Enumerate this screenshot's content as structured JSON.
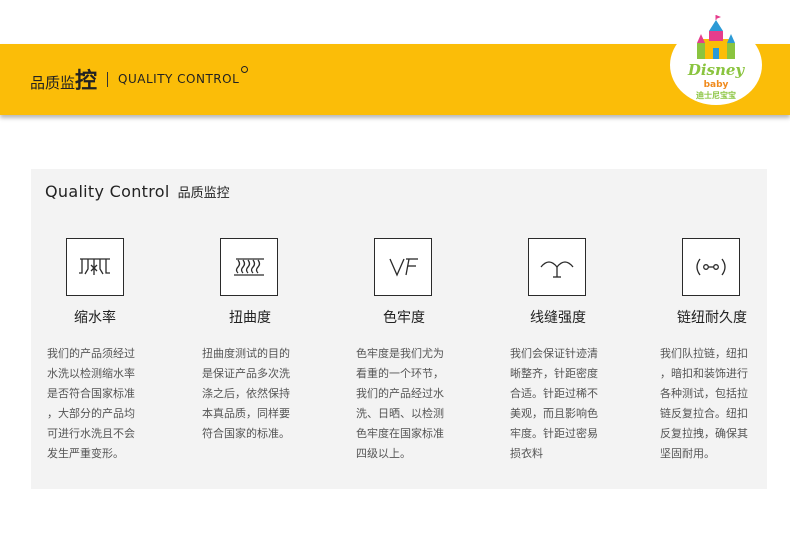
{
  "header": {
    "title_cn_prefix": "品质监",
    "title_cn_big": "控",
    "title_en": "QUALITY  CONTROL",
    "logo_text_en": "Disney",
    "logo_text_sub": "baby",
    "logo_text_cn": "迪士尼宝宝",
    "accent_color": "#fbbd08"
  },
  "panel": {
    "title_en": "Quality  Control",
    "title_cn": "品质监控"
  },
  "features": [
    {
      "icon": "shrink-water-icon",
      "title": "缩水率",
      "lines": [
        "我们的产品须经过",
        "水洗以检测缩水率",
        "是否符合国家标准",
        "，大部分的产品均",
        "可进行水洗且不会",
        "发生严重变形。"
      ]
    },
    {
      "icon": "twist-icon",
      "title": "扭曲度",
      "lines": [
        "扭曲度测试的目的",
        "是保证产品多次洗",
        "涤之后，依然保持",
        "本真品质，同样要",
        "符合国家的标准。"
      ]
    },
    {
      "icon": "color-fastness-icon",
      "title": "色牢度",
      "lines": [
        "色牢度是我们尤为",
        "看重的一个环节，",
        "我们的产品经过水",
        "洗、日晒、以检测",
        "色牢度在国家标准",
        "四级以上。"
      ]
    },
    {
      "icon": "seam-strength-icon",
      "title": "线缝强度",
      "lines": [
        "我们会保证针迹清",
        "晰整齐，针距密度",
        "合适。针距过稀不",
        "美观，而且影响色",
        "牢度。针距过密易",
        "损衣料"
      ]
    },
    {
      "icon": "zipper-durability-icon",
      "title": "链纽耐久度",
      "lines": [
        "我们队拉链，纽扣",
        "，暗扣和装饰进行",
        "各种测试，包括拉",
        "链反复拉合。纽扣",
        "反复拉拽，确保其",
        "坚固耐用。"
      ]
    }
  ]
}
